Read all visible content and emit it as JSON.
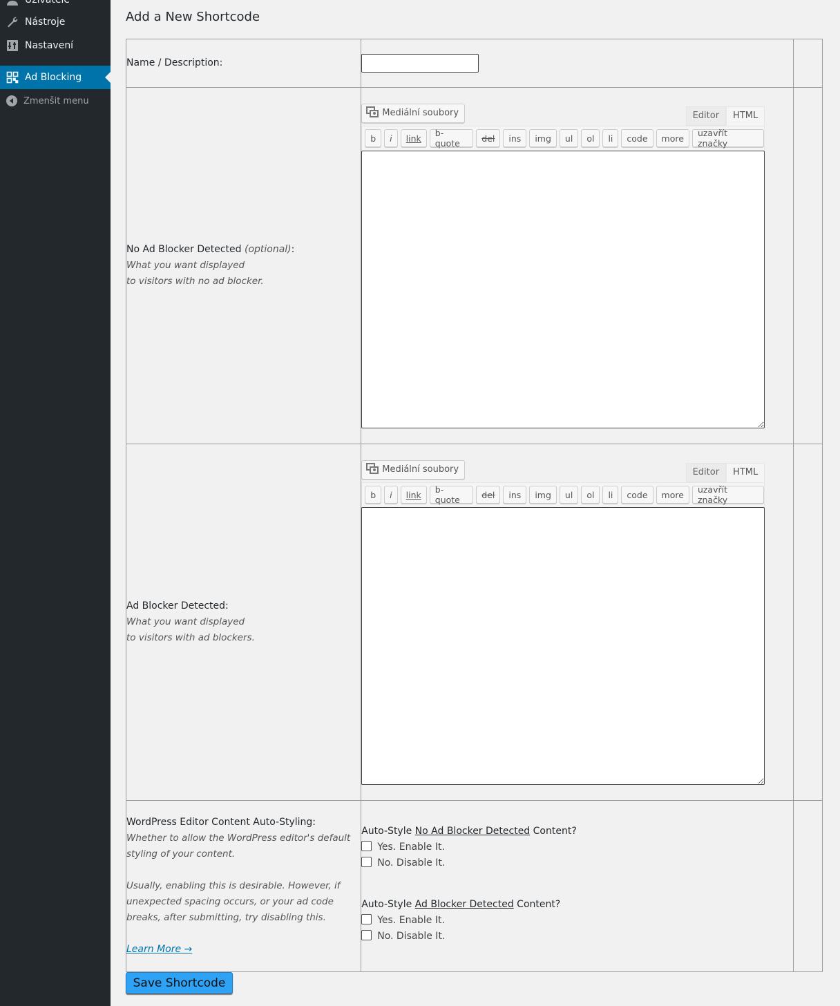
{
  "sidebar": {
    "items": [
      {
        "label": "Uživatelé",
        "icon": "user-icon"
      },
      {
        "label": "Nástroje",
        "icon": "wrench-icon"
      },
      {
        "label": "Nastavení",
        "icon": "settings-icon"
      },
      {
        "label": "Ad Blocking",
        "icon": "qr-icon",
        "active": true
      },
      {
        "label": "Zmenšit menu",
        "icon": "collapse-icon"
      }
    ]
  },
  "page": {
    "title": "Add a New Shortcode"
  },
  "form": {
    "name_label": "Name / Description:",
    "name_value": "",
    "no_ad": {
      "label": "No Ad Blocker Detected",
      "optional": "(optional)",
      "colon": ":",
      "desc1": "What you want displayed",
      "desc2": "to visitors with no ad blocker."
    },
    "ad": {
      "label": "Ad Blocker Detected:",
      "desc1": "What you want displayed",
      "desc2": "to visitors with ad blockers."
    },
    "editor": {
      "media_label": "Mediální soubory",
      "tab_editor": "Editor",
      "tab_html": "HTML",
      "buttons": [
        "b",
        "i",
        "link",
        "b-quote",
        "del",
        "ins",
        "img",
        "ul",
        "ol",
        "li",
        "code",
        "more",
        "uzavřít značky"
      ]
    },
    "autostyle": {
      "label": "WordPress Editor Content Auto-Styling:",
      "desc1": "Whether to allow the WordPress editor's default",
      "desc2": "styling of your content.",
      "desc3": "Usually, enabling this is desirable. However, if",
      "desc4": "unexpected spacing occurs, or your ad code",
      "desc5": "breaks, after submitting, try disabling this.",
      "learn_more": "Learn More →",
      "q1_pre": "Auto-Style ",
      "q1_link": "No Ad Blocker Detected",
      "q1_post": " Content?",
      "q2_pre": "Auto-Style ",
      "q2_link": "Ad Blocker Detected",
      "q2_post": " Content?",
      "yes": "Yes. Enable It.",
      "no": "No. Disable It."
    }
  },
  "save_label": "Save Shortcode",
  "colors": {
    "accent": "#0073aa",
    "sidebar": "#23282d",
    "save": "#2ea2f5"
  }
}
